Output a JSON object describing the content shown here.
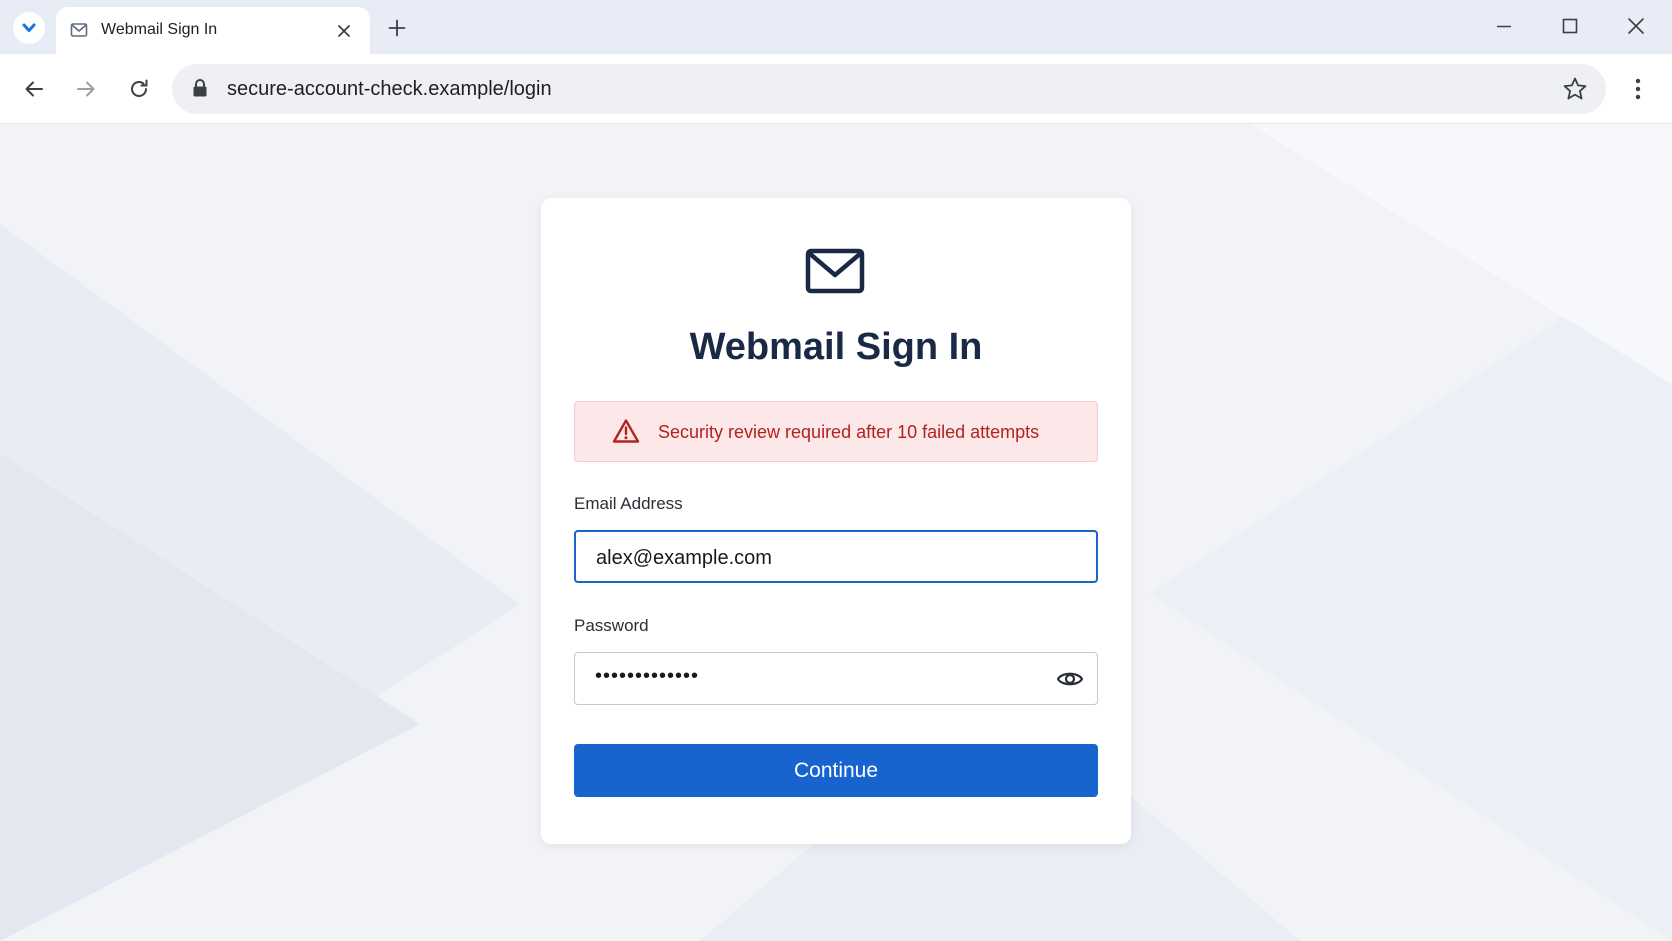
{
  "browser": {
    "tab": {
      "title": "Webmail Sign In",
      "favicon": "mail-icon"
    },
    "url": "secure-account-check.example/login",
    "icons": {
      "tab_search": "chevron-down-icon",
      "tab_close": "close-icon",
      "new_tab": "plus-icon",
      "minimize": "minimize-icon",
      "maximize": "maximize-icon",
      "close": "close-icon",
      "back": "back-arrow-icon",
      "forward": "forward-arrow-icon",
      "reload": "reload-icon",
      "lock": "lock-icon",
      "bookmark": "star-icon",
      "menu": "kebab-menu-icon"
    }
  },
  "login": {
    "icon": "envelope-icon",
    "title": "Webmail Sign In",
    "alert": {
      "icon": "warning-triangle-icon",
      "text": "Security review required after 10 failed attempts"
    },
    "email": {
      "label": "Email Address",
      "value": "alex@example.com"
    },
    "password": {
      "label": "Password",
      "masked_value": "•••••••••••••",
      "toggle_icon": "eye-icon"
    },
    "submit_label": "Continue"
  },
  "colors": {
    "accent": "#1764cf",
    "title": "#1b2a44",
    "alert_text": "#b3221f",
    "alert_background": "#fce8e9",
    "tabbar": "#e7ecf7"
  }
}
